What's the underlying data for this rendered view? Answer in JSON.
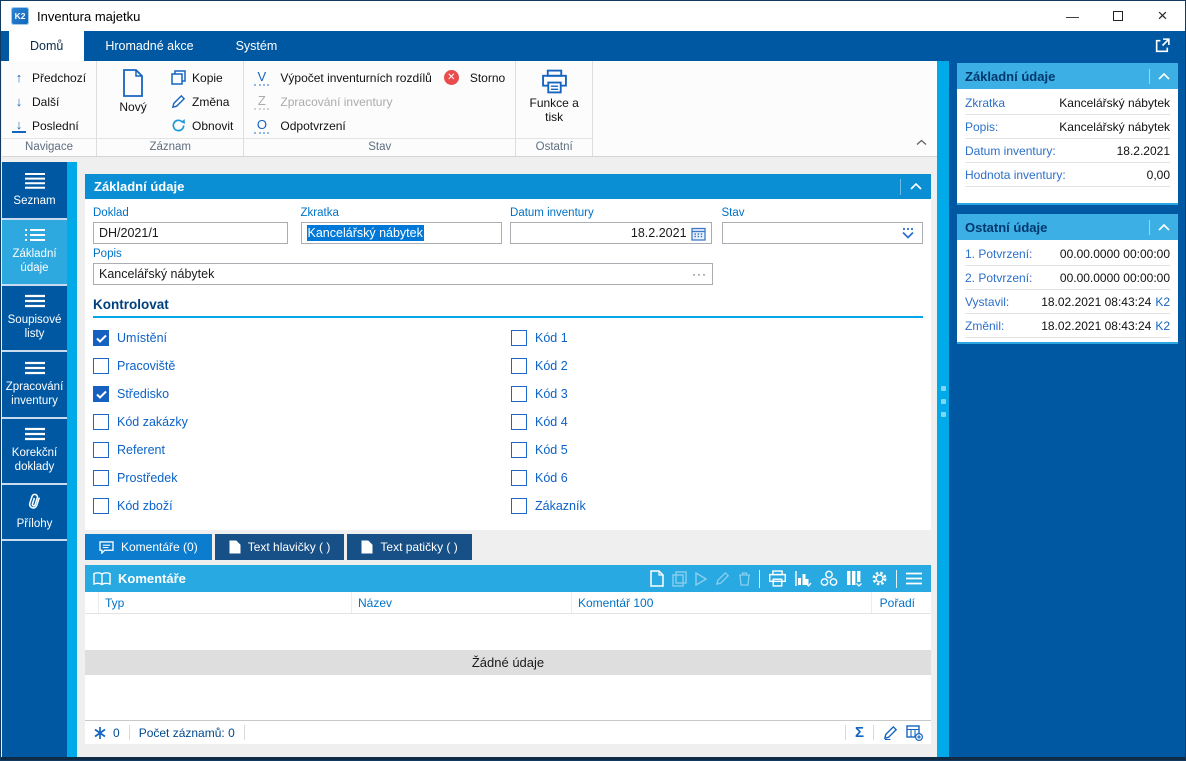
{
  "window": {
    "title": "Inventura majetku",
    "logo": "K2"
  },
  "ribbon": {
    "tabs": [
      {
        "label": "Domů"
      },
      {
        "label": "Hromadné akce"
      },
      {
        "label": "Systém"
      }
    ],
    "navigace": {
      "label": "Navigace",
      "items": [
        {
          "icon": "arrow-up-icon",
          "label": "Předchozí"
        },
        {
          "icon": "arrow-down-icon",
          "label": "Další"
        },
        {
          "icon": "arrow-down-bar-icon",
          "label": "Poslední"
        }
      ]
    },
    "zaznam": {
      "label": "Záznam",
      "novy": "Nový",
      "items": [
        {
          "icon": "copy-icon",
          "label": "Kopie"
        },
        {
          "icon": "pencil-icon",
          "label": "Změna"
        },
        {
          "icon": "refresh-icon",
          "label": "Obnovit"
        }
      ]
    },
    "stav": {
      "label": "Stav",
      "vypocet": {
        "key": "V",
        "label": "Výpočet inventurních rozdílů"
      },
      "storno": {
        "icon": "red-cross-circle-icon",
        "label": "Storno"
      },
      "zpracovani": {
        "key": "Z",
        "label": "Zpracování inventury",
        "disabled": true
      },
      "odpotvrzeni": {
        "key": "O",
        "label": "Odpotvrzení"
      }
    },
    "ostatni": {
      "label": "Ostatní",
      "funkce": "Funkce a tisk",
      "icon": "printer-icon"
    }
  },
  "sidebar": {
    "items": [
      {
        "icon": "menu-lines-icon",
        "label": "Seznam"
      },
      {
        "icon": "dotted-list-icon",
        "label": "Základní údaje",
        "active": true
      },
      {
        "icon": "menu-lines-icon",
        "label": "Soupisové listy"
      },
      {
        "icon": "menu-lines-icon",
        "label": "Zpracování inventury"
      },
      {
        "icon": "menu-lines-icon",
        "label": "Korekční doklady"
      },
      {
        "icon": "paperclip-icon",
        "label": "Přílohy"
      }
    ]
  },
  "form": {
    "header": "Základní údaje",
    "fields": {
      "doklad": {
        "label": "Doklad",
        "value": "DH/2021/1"
      },
      "zkratka": {
        "label": "Zkratka",
        "value": "Kancelářský nábytek",
        "selected": true
      },
      "datum": {
        "label": "Datum inventury",
        "value": "18.2.2021",
        "icon": "calendar-icon"
      },
      "stav": {
        "label": "Stav",
        "value": "",
        "icon": "dots-dropdown-icon"
      },
      "popis": {
        "label": "Popis",
        "value": "Kancelářský nábytek"
      }
    },
    "kontrolovat": {
      "heading": "Kontrolovat",
      "left": [
        {
          "label": "Umístění",
          "checked": true
        },
        {
          "label": "Pracoviště",
          "checked": false
        },
        {
          "label": "Středisko",
          "checked": true
        },
        {
          "label": "Kód zakázky",
          "checked": false
        },
        {
          "label": "Referent",
          "checked": false
        },
        {
          "label": "Prostředek",
          "checked": false
        },
        {
          "label": "Kód zboží",
          "checked": false
        }
      ],
      "right": [
        {
          "label": "Kód 1",
          "checked": false
        },
        {
          "label": "Kód 2",
          "checked": false
        },
        {
          "label": "Kód 3",
          "checked": false
        },
        {
          "label": "Kód 4",
          "checked": false
        },
        {
          "label": "Kód 5",
          "checked": false
        },
        {
          "label": "Kód 6",
          "checked": false
        },
        {
          "label": "Zákazník",
          "checked": false
        }
      ]
    }
  },
  "doc_tabs": [
    {
      "icon": "comment-bubble-icon",
      "label": "Komentáře (0)",
      "active": true
    },
    {
      "icon": "page-icon",
      "label": "Text hlavičky ( )"
    },
    {
      "icon": "page-icon",
      "label": "Text patičky ( )"
    }
  ],
  "grid": {
    "icon": "book-icon",
    "title": "Komentáře",
    "toolbar_icons": [
      "new-record-icon",
      "copy-record-icon",
      "run-icon",
      "edit-icon",
      "delete-icon",
      "print-icon",
      "chart-icon",
      "olap-icon",
      "columns-icon",
      "settings-icon",
      "menu-icon"
    ],
    "columns": [
      "Typ",
      "Název",
      "Komentář 100",
      "Pořadí"
    ],
    "empty": "Žádné údaje",
    "footer": {
      "frozen_count": "0",
      "count": "Počet záznamů: 0",
      "icons": [
        "snowflake-icon",
        "sum-icon",
        "edit-icon",
        "add-table-icon"
      ]
    }
  },
  "right_panel": {
    "popout_icon": "open-external-icon",
    "basic": {
      "header": "Základní údaje",
      "rows": [
        {
          "label": "Zkratka",
          "value": "Kancelářský nábytek"
        },
        {
          "label": "Popis:",
          "value": "Kancelářský nábytek"
        },
        {
          "label": "Datum inventury:",
          "value": "18.2.2021"
        },
        {
          "label": "Hodnota inventury:",
          "value": "0,00"
        }
      ]
    },
    "other": {
      "header": "Ostatní údaje",
      "rows": [
        {
          "label": "1. Potvrzení:",
          "value": "00.00.0000 00:00:00",
          "suffix": ""
        },
        {
          "label": "2. Potvrzení:",
          "value": "00.00.0000 00:00:00",
          "suffix": ""
        },
        {
          "label": "Vystavil:",
          "value": "18.02.2021 08:43:24",
          "suffix": "K2"
        },
        {
          "label": "Změnil:",
          "value": "18.02.2021 08:43:24",
          "suffix": "K2"
        }
      ]
    }
  },
  "colors": {
    "brand_blue": "#0058A3",
    "accent_cyan": "#00A9E8",
    "form_header_blue": "#0A8FD4",
    "panel_header_cyan": "#3CAFE4",
    "grid_header_cyan": "#29A9E1",
    "selection_blue": "#0078D7",
    "storno_red": "#E84C4C",
    "label_blue": "#0072C6"
  }
}
